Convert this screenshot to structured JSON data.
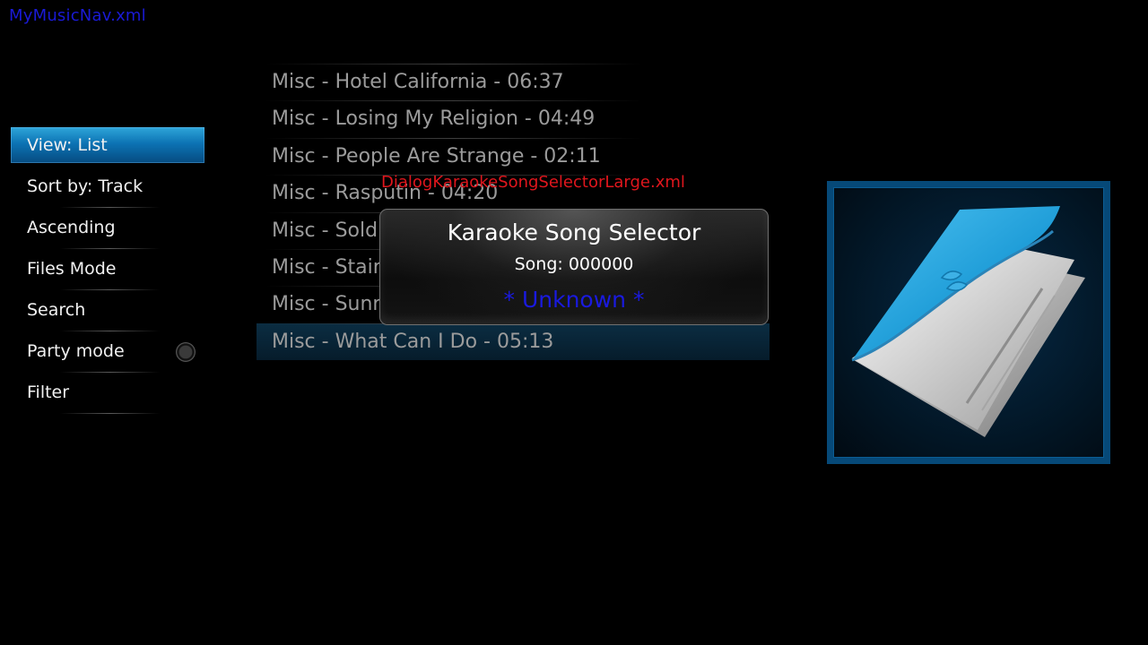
{
  "window_title": "MyMusicNav.xml",
  "side_menu": {
    "items": [
      {
        "label": "View: List"
      },
      {
        "label": "Sort by: Track"
      },
      {
        "label": "Ascending"
      },
      {
        "label": "Files Mode"
      },
      {
        "label": "Search"
      },
      {
        "label": "Party mode"
      },
      {
        "label": "Filter"
      }
    ]
  },
  "song_list": {
    "items": [
      {
        "label": "Misc - Hotel California - 06:37"
      },
      {
        "label": "Misc - Losing My Religion - 04:49"
      },
      {
        "label": "Misc - People Are Strange - 02:11"
      },
      {
        "label": "Misc - Rasputin - 04:20"
      },
      {
        "label": "Misc - Soldier Of"
      },
      {
        "label": "Misc - Stairway To Hea"
      },
      {
        "label": "Misc - Sunn"
      },
      {
        "label": "Misc - What Can I Do - 05:13"
      }
    ]
  },
  "dialog": {
    "file_label": "DialogKaraokeSongSelectorLarge.xml",
    "title": "Karaoke Song Selector",
    "song_line": "Song: 000000",
    "status": "* Unknown *"
  },
  "thumbnail": {
    "icon": "songbook-icon",
    "frame_color": "#064978",
    "book_color": "#1b9ad6"
  },
  "colors": {
    "accent": "#0c73b4",
    "title_blue": "#1a1ad6",
    "debug_red": "#e0161d"
  }
}
